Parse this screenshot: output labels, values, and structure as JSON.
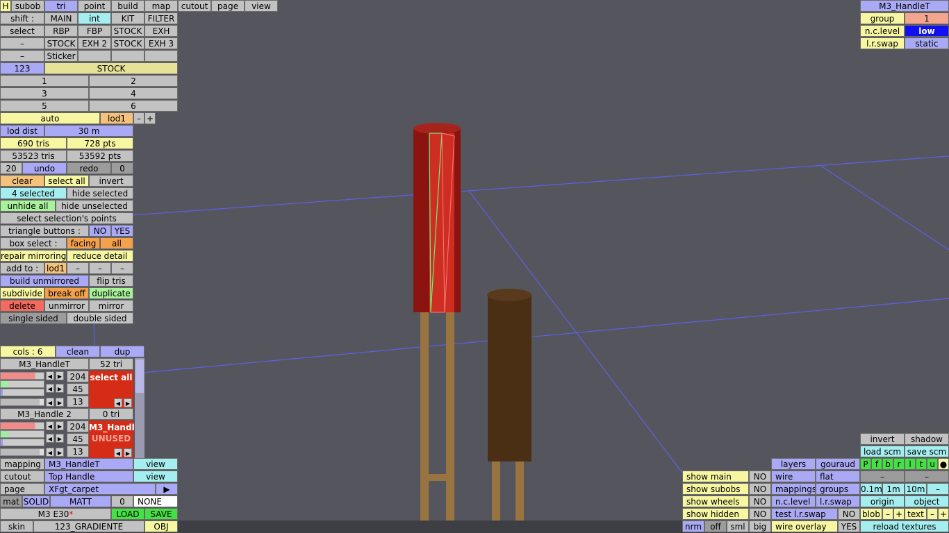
{
  "top_tabs": {
    "h": "H",
    "subob": "subob",
    "tri": "tri",
    "point": "point",
    "build": "build",
    "map": "map",
    "cutout": "cutout",
    "page": "page",
    "view": "view"
  },
  "shift_row": {
    "shift": "shift :",
    "main": "MAIN",
    "int": "int",
    "kit": "KIT",
    "filter": "FILTER"
  },
  "select_row": {
    "select": "select",
    "rbp": "RBP",
    "fbp": "FBP",
    "stock": "STOCK",
    "exh": "EXH"
  },
  "row3": {
    "dash": "–",
    "stock": "STOCK",
    "exh2": "EXH 2",
    "stock2": "STOCK",
    "exh3": "EXH 3"
  },
  "row4": {
    "dash": "–",
    "sticker": "Sticker"
  },
  "row5": {
    "num": "123",
    "stock": "STOCK"
  },
  "nums": [
    "1",
    "2",
    "3",
    "4",
    "5",
    "6"
  ],
  "lod": {
    "auto": "auto",
    "lod1": "lod1",
    "minus": "–",
    "plus": "+"
  },
  "stats": {
    "lod_dist_label": "lod dist",
    "lod_dist": "30 m",
    "tris": "690 tris",
    "pts": "728 pts",
    "total_tris": "53523 tris",
    "total_pts": "53592 pts",
    "undo_count": "20",
    "undo": "undo",
    "redo": "redo",
    "redo_count": "0"
  },
  "tools": {
    "clear": "clear",
    "select_all": "select all",
    "invert": "invert",
    "selected": "4 selected",
    "hide_selected": "hide selected",
    "unhide_all": "unhide all",
    "hide_unselected": "hide unselected",
    "select_points": "select selection's points",
    "tri_buttons": "triangle buttons :",
    "no": "NO",
    "yes": "YES",
    "box_select": "box select :",
    "facing": "facing",
    "all": "all",
    "repair": "repair mirroring",
    "reduce": "reduce detail",
    "add_to": "add to :",
    "add_lod": "lod1",
    "build_unmirrored": "build unmirrored",
    "flip_tris": "flip tris",
    "subdivide": "subdivide",
    "break_off": "break off",
    "duplicate": "duplicate",
    "delete": "delete",
    "unmirror": "unmirror",
    "mirror": "mirror",
    "single_sided": "single sided",
    "double_sided": "double sided"
  },
  "materials": {
    "cols": "cols : 6",
    "clean": "clean",
    "dup": "dup",
    "items": [
      {
        "name": "M3_HandleT",
        "tris": "52 tri",
        "r": "204",
        "g": "45",
        "b": "13",
        "panel": "select all",
        "panel2": ""
      },
      {
        "name": "M3_Handle 2",
        "tris": "0 tri",
        "r": "204",
        "g": "45",
        "b": "13",
        "panel": "M3_Handl",
        "panel2": "UNUSED"
      }
    ]
  },
  "bottom_left": {
    "mapping": "mapping",
    "mapping_val": "M3_HandleT",
    "view": "view",
    "cutout": "cutout",
    "cutout_val": "Top Handle",
    "view2": "view",
    "page": "page",
    "page_val": "XFgt_carpet",
    "play": "▶",
    "mat": "mat",
    "solid": "SOLID",
    "matt": "MATT",
    "zero": "0",
    "none": "NONE",
    "model": "M3 E30",
    "star": "*",
    "load": "LOAD",
    "save": "SAVE",
    "skin": "skin",
    "skin_val": "123_GRADIENTE",
    "obj": "OBJ"
  },
  "top_right": {
    "title": "M3_HandleT",
    "group": "group",
    "group_val": "1",
    "nc_level": "n.c.level",
    "nc_val": "low",
    "lr_swap": "l.r.swap",
    "lr_val": "static"
  },
  "bottom_right": {
    "invert": "invert",
    "shadow": "shadow",
    "load_scm": "load scm",
    "save_scm": "save scm",
    "layers": "layers",
    "gouraud": "gouraud",
    "pfbrltu": [
      "P",
      "f",
      "b",
      "r",
      "l",
      "t",
      "u",
      "●"
    ],
    "show_main": "show main",
    "show_subobs": "show subobs",
    "show_wheels": "show wheels",
    "show_hidden": "show hidden",
    "no": "NO",
    "wire": "wire",
    "flat": "flat",
    "dash": "–",
    "mappings": "mappings",
    "groups": "groups",
    "d01": "0.1m",
    "d1": "1m",
    "d10": "10m",
    "nc_level": "n.c.level",
    "lr_swap": "l.r.swap",
    "origin": "origin",
    "object": "object",
    "test_lr": "test l.r.swap",
    "blob": "blob",
    "minus": "–",
    "plus": "+",
    "text": "text",
    "nrm": "nrm",
    "off": "off",
    "sml": "sml",
    "big": "big",
    "wire_overlay": "wire overlay",
    "yes": "YES",
    "reload": "reload textures"
  },
  "colors": {
    "background": "#55565d",
    "grid_line": "#5e5ee6",
    "handle_red": "#8b1410",
    "handle_dark": "#4a2f14",
    "legs": "#9a7440"
  }
}
